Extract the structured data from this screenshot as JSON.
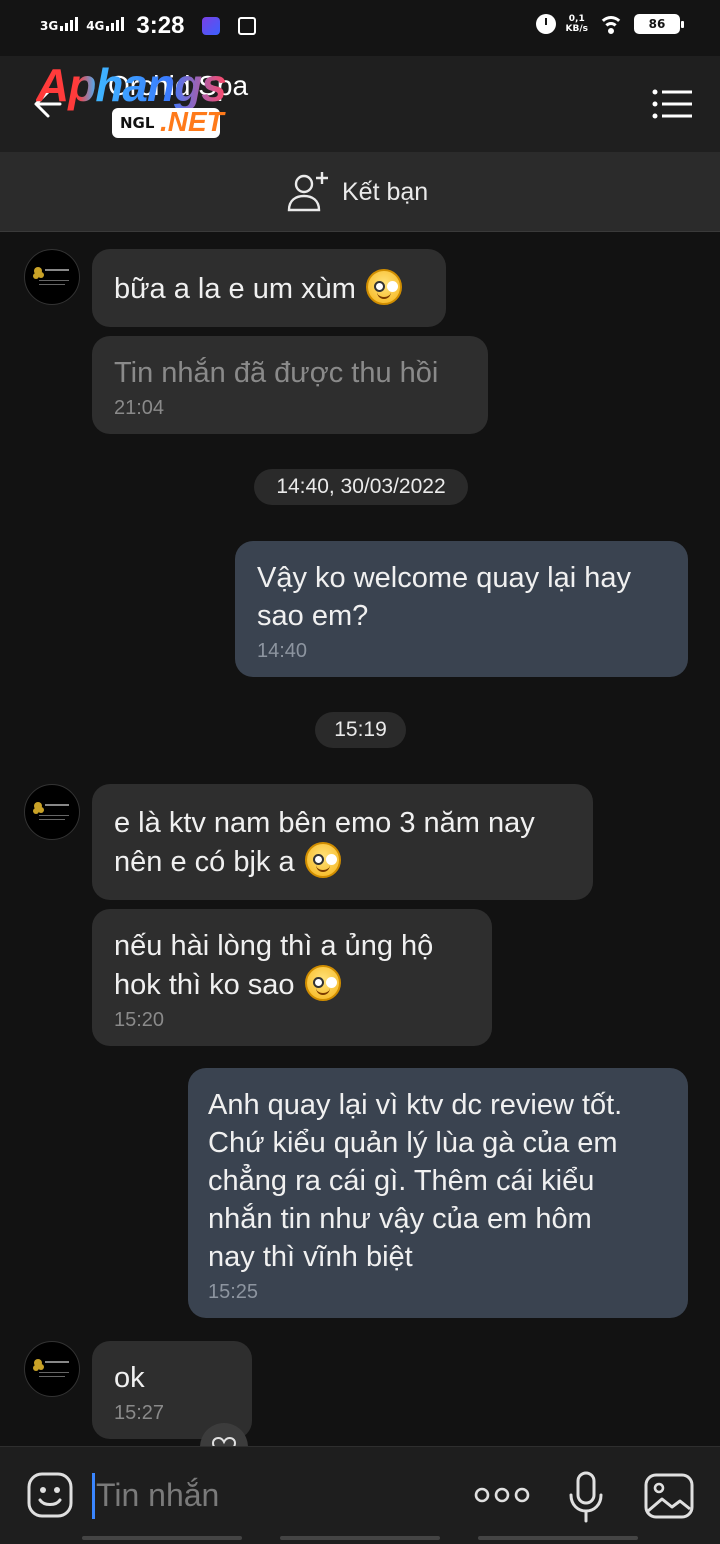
{
  "status_bar": {
    "net1": "3G",
    "net2": "4G",
    "time": "3:28",
    "speed_value": "0,1",
    "speed_unit": "KB/s",
    "battery": "86"
  },
  "header": {
    "title": "Orchid Spa",
    "watermark_main": "Aphangs",
    "watermark_tag_left": "NGL",
    "watermark_tag_right": ".NET"
  },
  "add_friend": {
    "label": "Kết bạn"
  },
  "messages": [
    {
      "side": "in",
      "text": "bữa a la e um xùm",
      "emoji": true
    },
    {
      "side": "in",
      "text": "Tin nhắn đã được thu hồi",
      "time": "21:04",
      "recalled": true
    },
    {
      "side": "date",
      "text": "14:40, 30/03/2022"
    },
    {
      "side": "out",
      "text": "Vậy ko welcome quay lại hay\nsao em?",
      "time": "14:40"
    },
    {
      "side": "date",
      "text": "15:19"
    },
    {
      "side": "in",
      "text": "e là ktv nam bên emo 3 năm nay\nnên e có bjk a",
      "emoji": true
    },
    {
      "side": "in",
      "text": "nếu hài lòng thì a ủng hộ\nhok thì ko sao",
      "emoji": true,
      "time": "15:20"
    },
    {
      "side": "out",
      "text": "Anh quay lại vì ktv dc review tốt.\nChứ kiểu quản lý lùa gà của em\nchẳng ra cái gì. Thêm cái kiểu\nnhắn tin như vậy của em hôm\nnay thì vĩnh biệt",
      "time": "15:25"
    },
    {
      "side": "in",
      "text": "ok",
      "time": "15:27"
    }
  ],
  "input": {
    "placeholder": "Tin nhắn"
  },
  "icons": {
    "back": "arrow-left-icon",
    "menu": "menu-list-icon",
    "add_friend": "add-user-icon",
    "emoji": "smiley-icon",
    "more": "more-dots-icon",
    "mic": "microphone-icon",
    "image": "image-icon",
    "reaction": "heart-icon"
  },
  "colors": {
    "background": "#121212",
    "incoming_bubble": "#2e2e2e",
    "outgoing_bubble": "#3a4350",
    "caret": "#3a86ff"
  }
}
